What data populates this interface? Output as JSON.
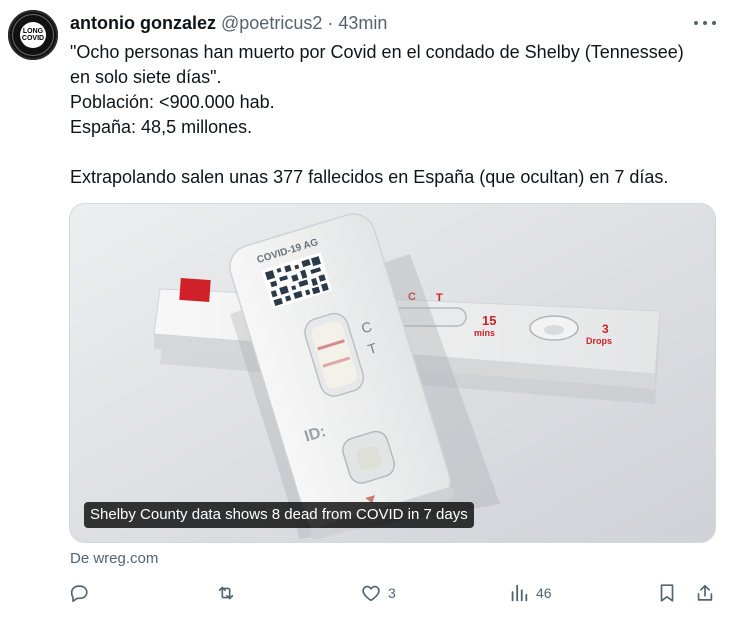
{
  "avatar": {
    "line1": "LONG",
    "line2": "COVID"
  },
  "author": {
    "name": "antonio gonzalez",
    "handle": "@poetricus2",
    "separator": "·",
    "time": "43min"
  },
  "tweet": {
    "line1": "\"Ocho personas han muerto por Covid en el condado de Shelby (Tennessee)",
    "line2": "en solo siete días\".",
    "line3": "Población: <900.000 hab.",
    "line4": "España: 48,5 millones.",
    "line5": "Extrapolando salen unas 377 fallecidos en España (que ocultan) en 7 días."
  },
  "media": {
    "caption": "Shelby County data shows 8 dead from COVID in 7 days",
    "test_label": "COVID-19 AG",
    "mark_c": "C",
    "mark_t": "T",
    "mark_id": "ID:",
    "back_c": "C",
    "back_t": "T",
    "back_time": "15",
    "back_time_unit": "mins",
    "back_drops": "3",
    "back_drops_unit": "Drops"
  },
  "source": "De wreg.com",
  "actions": {
    "reply_count": "",
    "retweet_count": "",
    "like_count": "3",
    "views_count": "46"
  },
  "colors": {
    "text": "#0f1419",
    "secondary": "#536471",
    "border": "#cfd9de",
    "accent_red": "#d0202a"
  }
}
